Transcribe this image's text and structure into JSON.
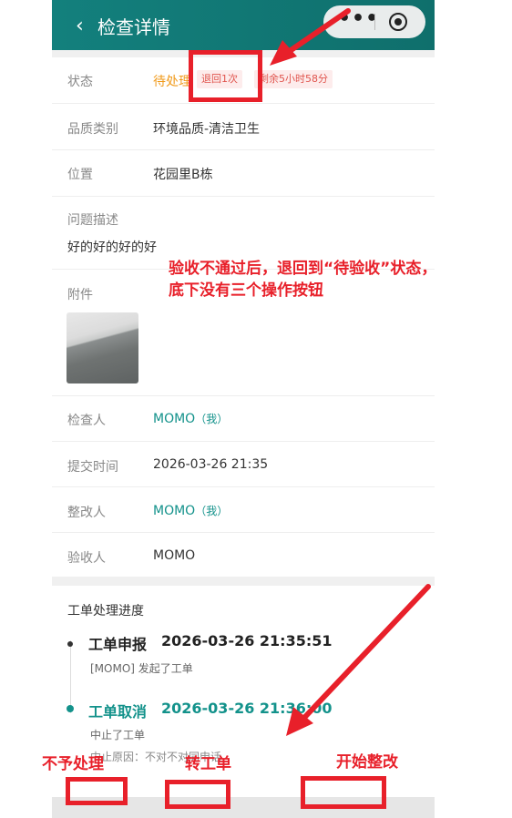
{
  "header": {
    "back_icon": "chevron-left-icon",
    "title": "检查详情",
    "more_icon": "more-dots-icon",
    "close_icon": "target-icon"
  },
  "details": {
    "status": {
      "label": "状态",
      "value": "待处理",
      "badge_returns": "退回1次",
      "badge_remaining": "剩余5小时58分"
    },
    "quality_type": {
      "label": "品质类别",
      "value": "环境品质-清洁卫生"
    },
    "location": {
      "label": "位置",
      "value": "花园里B栋"
    },
    "problem": {
      "label": "问题描述",
      "value": "好的好的好的好"
    },
    "attachment": {
      "label": "附件"
    },
    "inspector": {
      "label": "检查人",
      "name": "MOMO",
      "me": "（我）"
    },
    "submit_time": {
      "label": "提交时间",
      "value": "2026-03-26 21:35"
    },
    "rectifier": {
      "label": "整改人",
      "name": "MOMO",
      "me": "（我）"
    },
    "acceptor": {
      "label": "验收人",
      "value": "MOMO"
    }
  },
  "progress": {
    "title": "工单处理进度",
    "steps": [
      {
        "name": "工单申报",
        "time": "2026-03-26 21:35:51",
        "desc": "[MOMO] 发起了工单"
      },
      {
        "name": "工单取消",
        "time": "2026-03-26 21:36:00",
        "desc": "中止了工单",
        "reason": "中止原因：不对不对同申话"
      }
    ]
  },
  "annotations": {
    "note": "验收不通过后，退回到“待验收”状态，\n底下没有三个操作按钮",
    "label_no_handle": "不予处理",
    "label_transfer": "转工单",
    "label_start": "开始整改"
  },
  "colors": {
    "primary": "#13807d",
    "status": "#f09a1a",
    "badge": "#e0554e",
    "annotation": "#e8202a",
    "link": "#13928b"
  }
}
